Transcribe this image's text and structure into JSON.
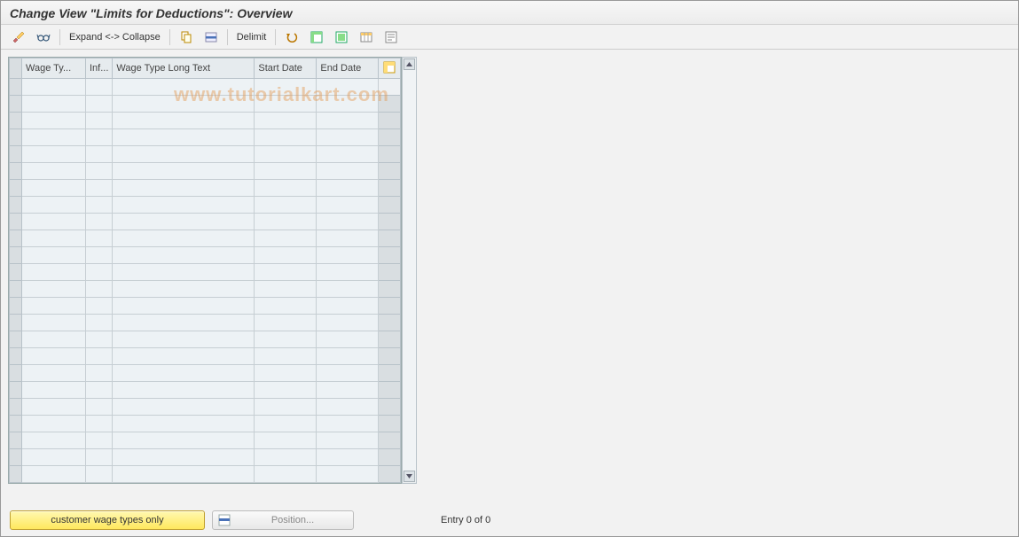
{
  "header": {
    "title": "Change View \"Limits for Deductions\": Overview"
  },
  "toolbar": {
    "expand_label": "Expand <-> Collapse",
    "delimit_label": "Delimit"
  },
  "grid": {
    "columns": {
      "wage_type": "Wage Ty...",
      "infotype": "Inf...",
      "long_text": "Wage Type Long Text",
      "start_date": "Start Date",
      "end_date": "End Date"
    },
    "row_count": 24
  },
  "footer": {
    "customer_btn": "customer wage types only",
    "position_btn": "Position...",
    "entry_status": "Entry 0 of 0"
  },
  "watermark": "www.tutorialkart.com"
}
